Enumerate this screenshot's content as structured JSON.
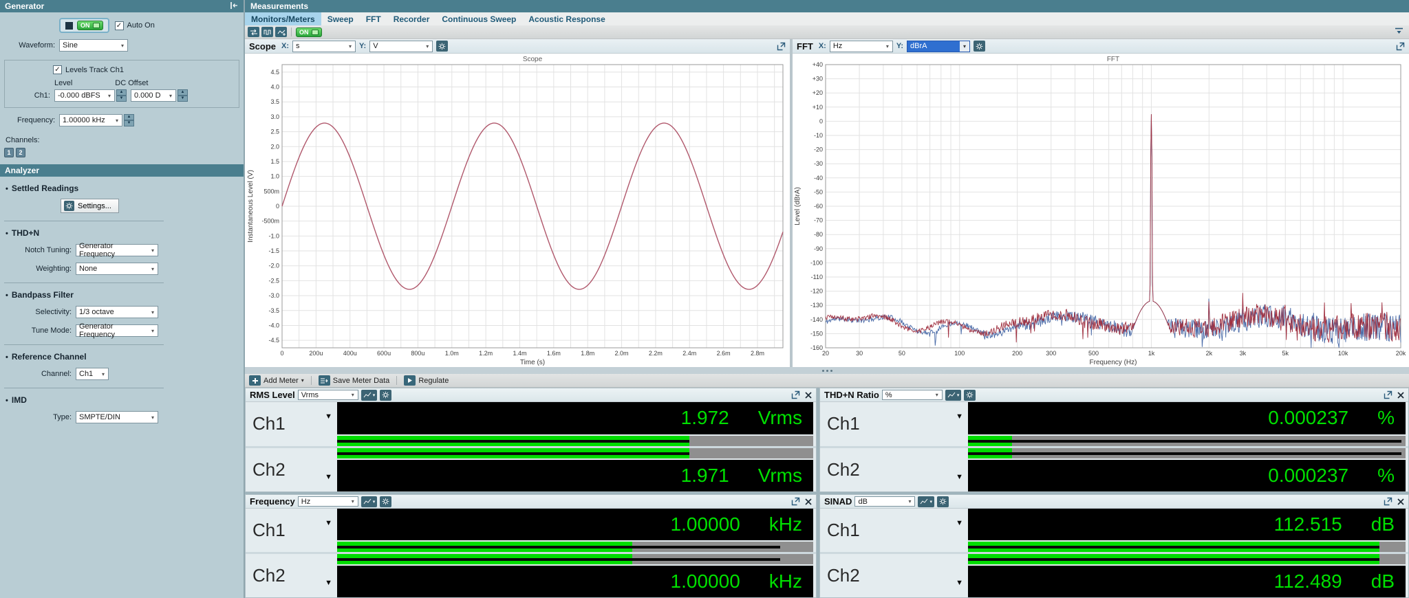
{
  "generator": {
    "title": "Generator",
    "on_label": "ON",
    "auto_on_label": "Auto On",
    "waveform_label": "Waveform:",
    "waveform": "Sine",
    "levels_track_label": "Levels Track Ch1",
    "level_label": "Level",
    "dc_offset_label": "DC Offset",
    "ch1_label": "Ch1:",
    "ch1_level": "-0.000 dBFS",
    "dc_offset": "0.000 D",
    "frequency_label": "Frequency:",
    "frequency": "1.00000 kHz",
    "channels_label": "Channels:",
    "channel_buttons": [
      "1",
      "2"
    ]
  },
  "analyzer": {
    "title": "Analyzer",
    "settled_heading": "Settled Readings",
    "settings_button": "Settings...",
    "thdn_heading": "THD+N",
    "notch_label": "Notch Tuning:",
    "notch": "Generator Frequency",
    "weighting_label": "Weighting:",
    "weighting": "None",
    "bandpass_heading": "Bandpass Filter",
    "selectivity_label": "Selectivity:",
    "selectivity": "1/3 octave",
    "tune_label": "Tune Mode:",
    "tune": "Generator Frequency",
    "refch_heading": "Reference Channel",
    "channel_label": "Channel:",
    "channel": "Ch1",
    "imd_heading": "IMD",
    "type_label": "Type:",
    "type": "SMPTE/DIN"
  },
  "measurements": {
    "title": "Measurements",
    "tabs": [
      "Monitors/Meters",
      "Sweep",
      "FFT",
      "Recorder",
      "Continuous Sweep",
      "Acoustic Response"
    ],
    "active_tab": "Monitors/Meters",
    "toolbar_on": "ON"
  },
  "scope_panel": {
    "title": "Scope",
    "x_label": "X:",
    "x_unit": "s",
    "y_label": "Y:",
    "y_unit": "V"
  },
  "fft_panel": {
    "title": "FFT",
    "x_label": "X:",
    "x_unit": "Hz",
    "y_label": "Y:",
    "y_unit": "dBrA"
  },
  "meter_toolbar": {
    "add_meter": "Add Meter",
    "save": "Save Meter Data",
    "regulate": "Regulate"
  },
  "meters": [
    {
      "title": "RMS Level",
      "unit": "Vrms",
      "channels": [
        {
          "label": "Ch1",
          "value": "1.972",
          "unit": "Vrms",
          "bar_fill": 74,
          "bar_line": 74
        },
        {
          "label": "Ch2",
          "value": "1.971",
          "unit": "Vrms",
          "bar_fill": 74,
          "bar_line": 74
        }
      ]
    },
    {
      "title": "THD+N Ratio",
      "unit": "%",
      "channels": [
        {
          "label": "Ch1",
          "value": "0.000237",
          "unit": "%",
          "bar_fill": 10,
          "bar_line": 99
        },
        {
          "label": "Ch2",
          "value": "0.000237",
          "unit": "%",
          "bar_fill": 10,
          "bar_line": 99
        }
      ]
    },
    {
      "title": "Frequency",
      "unit": "Hz",
      "channels": [
        {
          "label": "Ch1",
          "value": "1.00000",
          "unit": "kHz",
          "bar_fill": 62,
          "bar_line": 93
        },
        {
          "label": "Ch2",
          "value": "1.00000",
          "unit": "kHz",
          "bar_fill": 62,
          "bar_line": 93
        }
      ]
    },
    {
      "title": "SINAD",
      "unit": "dB",
      "channels": [
        {
          "label": "Ch1",
          "value": "112.515",
          "unit": "dB",
          "bar_fill": 94,
          "bar_line": 94
        },
        {
          "label": "Ch2",
          "value": "112.489",
          "unit": "dB",
          "bar_fill": 94,
          "bar_line": 94
        }
      ]
    }
  ],
  "colors": {
    "header_teal": "#4a7e8e",
    "active_tab": "#a8d4ec",
    "meter_green": "#00dc00",
    "meter_value_text": "#00e000",
    "scope_trace": "#b0576b",
    "fft_trace_ch1": "#a03040",
    "fft_trace_ch2": "#4a6ba8"
  },
  "chart_data": [
    {
      "type": "line",
      "title": "Scope",
      "xlabel": "Time (s)",
      "ylabel": "Instantaneous Level (V)",
      "xlim": [
        0,
        0.00295
      ],
      "ylim": [
        -4.75,
        4.75
      ],
      "grid_x_step": 0.0001,
      "grid_y_step": 0.5,
      "x_ticks": [
        [
          0,
          "0"
        ],
        [
          0.0002,
          "200u"
        ],
        [
          0.0004,
          "400u"
        ],
        [
          0.0006,
          "600u"
        ],
        [
          0.0008,
          "800u"
        ],
        [
          0.001,
          "1.0m"
        ],
        [
          0.0012,
          "1.2m"
        ],
        [
          0.0014,
          "1.4m"
        ],
        [
          0.0016,
          "1.6m"
        ],
        [
          0.0018,
          "1.8m"
        ],
        [
          0.002,
          "2.0m"
        ],
        [
          0.0022,
          "2.2m"
        ],
        [
          0.0024,
          "2.4m"
        ],
        [
          0.0026,
          "2.6m"
        ],
        [
          0.0028,
          "2.8m"
        ]
      ],
      "y_ticks": [
        [
          4.5,
          "4.5"
        ],
        [
          4,
          "4.0"
        ],
        [
          3.5,
          "3.5"
        ],
        [
          3,
          "3.0"
        ],
        [
          2.5,
          "2.5"
        ],
        [
          2,
          "2.0"
        ],
        [
          1.5,
          "1.5"
        ],
        [
          1,
          "1.0"
        ],
        [
          0.5,
          "500m"
        ],
        [
          0,
          "0"
        ],
        [
          -0.5,
          "-500m"
        ],
        [
          -1,
          "-1.0"
        ],
        [
          -1.5,
          "-1.5"
        ],
        [
          -2,
          "-2.0"
        ],
        [
          -2.5,
          "-2.5"
        ],
        [
          -3,
          "-3.0"
        ],
        [
          -3.5,
          "-3.5"
        ],
        [
          -4,
          "-4.0"
        ],
        [
          -4.5,
          "-4.5"
        ]
      ],
      "series": [
        {
          "name": "Ch1",
          "waveform": "sine",
          "amplitude_v": 2.789,
          "frequency_hz": 1000,
          "color": "#b0576b"
        }
      ]
    },
    {
      "type": "line",
      "title": "FFT",
      "xlabel": "Frequency (Hz)",
      "ylabel": "Level (dBrA)",
      "x_scale": "log",
      "xlim": [
        20,
        20000
      ],
      "ylim": [
        -160,
        40
      ],
      "y_tick_step": 10,
      "x_ticks": [
        [
          20,
          "20"
        ],
        [
          30,
          "30"
        ],
        [
          50,
          "50"
        ],
        [
          100,
          "100"
        ],
        [
          200,
          "200"
        ],
        [
          300,
          "300"
        ],
        [
          500,
          "500"
        ],
        [
          1000,
          "1k"
        ],
        [
          2000,
          "2k"
        ],
        [
          3000,
          "3k"
        ],
        [
          5000,
          "5k"
        ],
        [
          10000,
          "10k"
        ],
        [
          20000,
          "20k"
        ]
      ],
      "series": [
        {
          "name": "Ch2",
          "color": "#4a6ba8",
          "noise_floor_db": -144,
          "fundamental": {
            "freq_hz": 1000,
            "level_db": 5
          },
          "harmonics": [
            [
              2000,
              -122
            ],
            [
              3000,
              -130
            ],
            [
              5000,
              -133
            ],
            [
              7000,
              -131
            ]
          ],
          "seed": 11
        },
        {
          "name": "Ch1",
          "color": "#a03040",
          "noise_floor_db": -143,
          "fundamental": {
            "freq_hz": 1000,
            "level_db": 5
          },
          "harmonics": [
            [
              2000,
              -124
            ],
            [
              3000,
              -121
            ],
            [
              4000,
              -132
            ],
            [
              5000,
              -126
            ],
            [
              6000,
              -131
            ],
            [
              8000,
              -128
            ],
            [
              11000,
              -127
            ],
            [
              16000,
              -125
            ]
          ],
          "seed": 5
        }
      ]
    }
  ]
}
